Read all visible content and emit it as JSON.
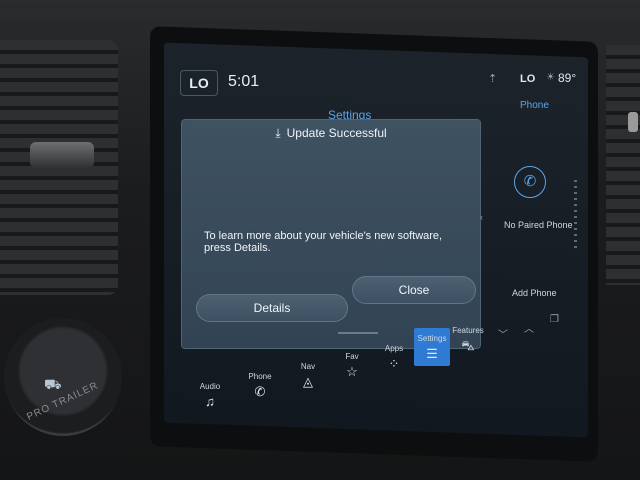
{
  "status": {
    "lo_left": "LO",
    "time": "5:01",
    "lo_right": "LO",
    "temp": "89°"
  },
  "page_title": "Settings",
  "dialog": {
    "title": "Update Successful",
    "message": "To learn more about your vehicle's new software, press Details.",
    "details_label": "Details",
    "close_label": "Close"
  },
  "phone_panel": {
    "title": "Phone",
    "no_paired": "No Paired Phone",
    "add_phone": "Add Phone"
  },
  "nav": {
    "audio": "Audio",
    "phone": "Phone",
    "nav": "Nav",
    "fav": "Fav",
    "apps": "Apps",
    "settings": "Settings",
    "features": "Features"
  },
  "knob_label": "PRO TRAILER",
  "icons": {
    "download": "download-icon",
    "phone": "phone-icon",
    "music": "music-icon",
    "star": "star-icon",
    "grid": "grid-icon",
    "sliders": "sliders-icon"
  },
  "colors": {
    "accent": "#2f7bd4",
    "link": "#5aa6ee",
    "dialog_bg": "#3a4c5c"
  }
}
